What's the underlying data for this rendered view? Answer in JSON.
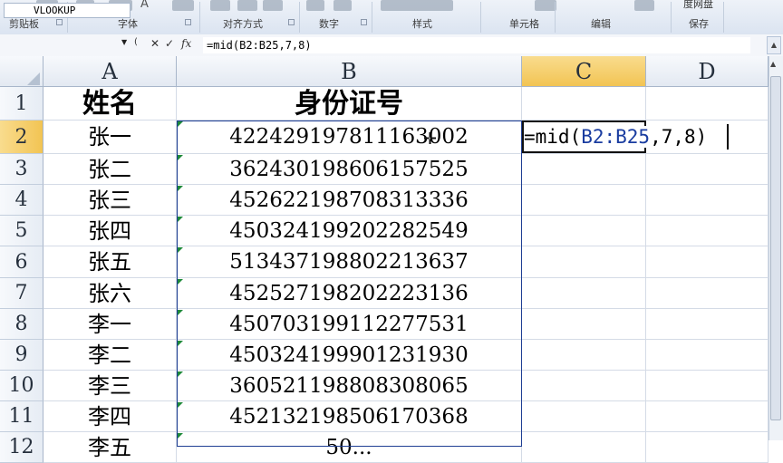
{
  "ribbon": {
    "groups": [
      {
        "label": "剪贴板"
      },
      {
        "label": "字体"
      },
      {
        "label": "对齐方式"
      },
      {
        "label": "数字"
      },
      {
        "label": "样式"
      },
      {
        "label": "单元格"
      },
      {
        "label": "编辑"
      },
      {
        "label": "保存"
      }
    ],
    "baidu_label": "度网盘",
    "a_glyph": "A",
    "percent_glyph": "%"
  },
  "formula_bar": {
    "name_box": "VLOOKUP",
    "cancel_glyph": "✕",
    "enter_glyph": "✓",
    "fx_glyph": "fx",
    "formula": "=mid(B2:B25,7,8)"
  },
  "columns": [
    "A",
    "B",
    "C",
    "D"
  ],
  "rows": [
    "1",
    "2",
    "3",
    "4",
    "5",
    "6",
    "7",
    "8",
    "9",
    "10",
    "11",
    "12"
  ],
  "sheet": {
    "header_name": "姓名",
    "header_id": "身份证号",
    "records": [
      {
        "name": "张一",
        "id": "422429197811163002"
      },
      {
        "name": "张二",
        "id": "362430198606157525"
      },
      {
        "name": "张三",
        "id": "452622198708313336"
      },
      {
        "name": "张四",
        "id": "450324199202282549"
      },
      {
        "name": "张五",
        "id": "513437198802213637"
      },
      {
        "name": "张六",
        "id": "452527198202223136"
      },
      {
        "name": "李一",
        "id": "450703199112277531"
      },
      {
        "name": "李二",
        "id": "450324199901231930"
      },
      {
        "name": "李三",
        "id": "360521198808308065"
      },
      {
        "name": "李四",
        "id": "452132198506170368"
      },
      {
        "name": "李五",
        "id": "50..."
      }
    ]
  },
  "edit": {
    "prefix": "=mid(",
    "ref": "B2:B25",
    "suffix": ",7,8)"
  }
}
